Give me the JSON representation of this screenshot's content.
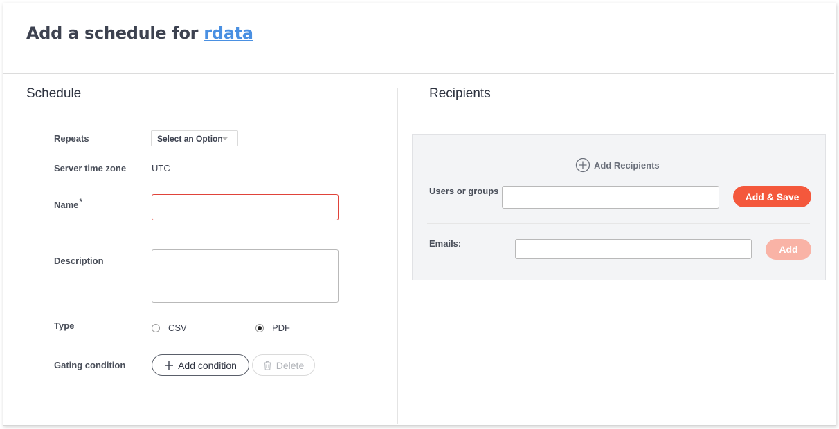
{
  "header": {
    "title_prefix": "Add a schedule for",
    "title_link": "rdata"
  },
  "schedule": {
    "section_title": "Schedule",
    "repeats": {
      "label": "Repeats",
      "selected": "Select an Option"
    },
    "timezone": {
      "label": "Server time zone",
      "value": "UTC"
    },
    "name": {
      "label": "Name",
      "required_mark": "*",
      "value": ""
    },
    "description": {
      "label": "Description",
      "value": ""
    },
    "type": {
      "label": "Type",
      "options": [
        {
          "label": "CSV",
          "selected": false
        },
        {
          "label": "PDF",
          "selected": true
        }
      ]
    },
    "gating": {
      "label": "Gating condition",
      "add_label": "Add condition",
      "delete_label": "Delete"
    }
  },
  "recipients": {
    "section_title": "Recipients",
    "add_recipients_label": "Add Recipients",
    "users": {
      "label": "Users or groups",
      "value": "",
      "button": "Add & Save"
    },
    "emails": {
      "label": "Emails:",
      "value": "",
      "button": "Add"
    }
  },
  "colors": {
    "primary": "#f4583c",
    "primary_disabled": "#f9b3a6",
    "link": "#4a90e2",
    "error_border": "#e0433a"
  },
  "icons": {
    "add_condition": "plus-icon",
    "delete": "trash-icon",
    "add_recipients": "plus-circle-icon",
    "select": "chevron-down-icon"
  }
}
